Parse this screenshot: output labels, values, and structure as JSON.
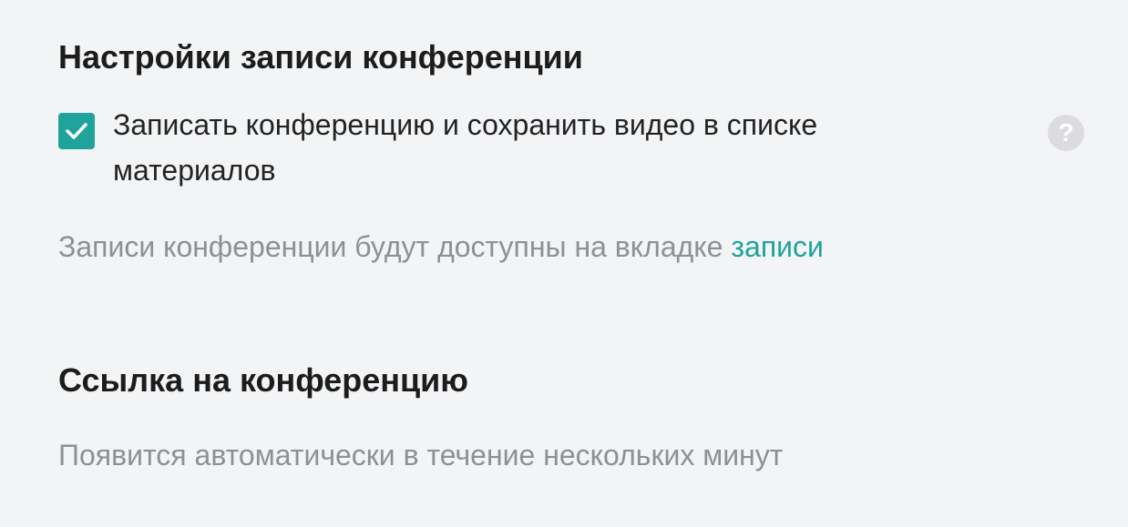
{
  "recording": {
    "title": "Настройки записи конференции",
    "checkbox_label": "Записать конференцию и сохранить видео в списке материалов",
    "checked": true,
    "hint_text": "Записи конференции будут доступны на вкладке ",
    "hint_link": "записи",
    "help_icon": "?"
  },
  "link": {
    "title": "Ссылка на конференцию",
    "status": "Появится автоматически в течение нескольких минут"
  },
  "colors": {
    "accent": "#1fa39c",
    "background": "#f3f4f6",
    "muted_text": "#8f9094",
    "help_icon_bg": "#dcdcdf"
  }
}
